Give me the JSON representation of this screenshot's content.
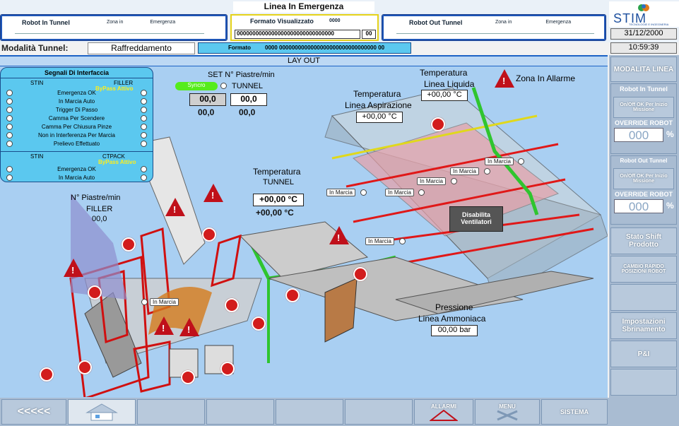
{
  "header": {
    "title": "Linea In Emergenza",
    "robot_in": {
      "title": "Robot In Tunnel",
      "col1": "Zona in",
      "col2": "Emergenza"
    },
    "formato_vis": {
      "title": "Formato Visualizzato",
      "code": "0000",
      "bar": "0000000000000000000000000000000",
      "small": "00"
    },
    "robot_out": {
      "title": "Robot Out Tunnel",
      "col1": "Zona in",
      "col2": "Emergenza"
    },
    "logo": "STIM",
    "logo_sub": "TECNOLOGIE E INGEGNERIA",
    "date": "31/12/2000",
    "time": "10:59:39",
    "modalita_label": "Modalità Tunnel:",
    "modalita_value": "Raffreddamento",
    "formato_label": "Formato",
    "formato_value": "0000 0000000000000000000000000000000 00"
  },
  "layout_title": "LAY OUT",
  "signals": {
    "title": "Segnali Di Interfaccia",
    "stin": "STIN",
    "filler": "FILLER",
    "bypass1": "ByPass Attivo",
    "items1": [
      "Emergenza OK",
      "In Marcia Auto",
      "Trigger Di Passo",
      "Camma Per Scendere",
      "Camma Per Chiusura Pinze",
      "Non in Interferenza Per Marcia",
      "Prelievo Effettuato"
    ],
    "stin2": "STIN",
    "ctpack": "CTPACK",
    "bypass2": "ByPass Attivo",
    "items2": [
      "Emergenza OK",
      "In Marcia Auto"
    ]
  },
  "set_piastre": {
    "title": "SET N° Piastre/min",
    "syncro": "Syncro",
    "tunnel": "TUNNEL",
    "v1": "00,0",
    "v2": "00,0",
    "v3": "00,0",
    "v4": "00,0"
  },
  "filler_piastre": {
    "label1": "N° Piastre/min",
    "label2": "FILLER",
    "value": "00,0"
  },
  "temp_tunnel": {
    "label1": "Temperatura",
    "label2": "TUNNEL",
    "set": "+00,00 °C",
    "actual": "+00,00 °C"
  },
  "temp_asp": {
    "label1": "Temperatura",
    "label2": "Linea Aspirazione",
    "value": "+00,00 °C"
  },
  "temp_liq": {
    "label1": "Temperatura",
    "label2": "Linea Liquida",
    "value": "+00,00 °C"
  },
  "zona_allarme": "Zona In Allarme",
  "pressione": {
    "label1": "Pressione",
    "label2": "Linea Ammoniaca",
    "value": "00,00 bar"
  },
  "disabilita": "Disabilita Ventilatori",
  "in_marcia": "In Marcia",
  "sidebar": {
    "modalita": "MODALITA LINEA",
    "robot_in": "Robot In Tunnel",
    "onoff1": "On/Off OK Per Inizio Missione",
    "override1": "OVERRIDE ROBOT",
    "override1_val": "000",
    "pct": "%",
    "robot_out": "Robot Out Tunnel",
    "onoff2": "On/Off OK Per Inizio Missione",
    "override2": "OVERRIDE ROBOT",
    "override2_val": "000",
    "stato": "Stato Shift Prodotto",
    "cambio": "CAMBIO RAPIDO POSIZIONI ROBOT",
    "impostazioni": "Impostazioni Sbrinamento",
    "pi": "P&I"
  },
  "footer": {
    "back": "<<<<<",
    "allarmi": "ALLARMI",
    "menu": "MENU",
    "sistema": "SISTEMA"
  },
  "colors": {
    "panel_blue": "#1e56b8",
    "cyan": "#5bc8ef",
    "sidebar": "#b8c9dc",
    "warning": "#c0101a",
    "guard_green": "#2fc52f",
    "formato_yellow": "#e5d21a"
  }
}
